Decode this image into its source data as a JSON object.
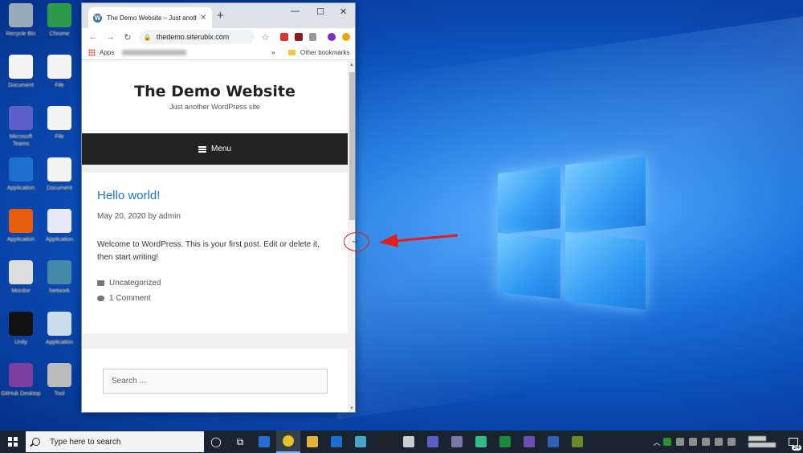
{
  "desktop": {
    "icons": [
      {
        "name": "Recycle Bin"
      },
      {
        "name": "Chrome"
      },
      {
        "name": "Document"
      },
      {
        "name": "File"
      },
      {
        "name": "Microsoft Teams"
      },
      {
        "name": "File"
      },
      {
        "name": "Application"
      },
      {
        "name": "Document"
      },
      {
        "name": "Application"
      },
      {
        "name": "Application"
      },
      {
        "name": "Monitor"
      },
      {
        "name": "Network"
      },
      {
        "name": "Unity"
      },
      {
        "name": "Application"
      },
      {
        "name": "GitHub Desktop"
      },
      {
        "name": "Tool"
      }
    ]
  },
  "browser": {
    "tab_title": "The Demo Website – Just another",
    "tab_close": "✕",
    "new_tab": "+",
    "minimize": "—",
    "maximize": "☐",
    "close": "✕",
    "back": "←",
    "forward": "→",
    "reload": "↻",
    "url": "thedemo.siterubix.com",
    "star": "☆",
    "bookmarks": {
      "apps": "Apps",
      "more": "»",
      "other": "Other bookmarks"
    }
  },
  "site": {
    "title": "The Demo Website",
    "tagline": "Just another WordPress site",
    "menu_label": "Menu",
    "post": {
      "title": "Hello world!",
      "meta": "May 20, 2020 by admin",
      "body": "Welcome to WordPress. This is your first post. Edit or delete it, then start writing!",
      "category": "Uncategorized",
      "comments": "1 Comment"
    },
    "search_placeholder": "Search ..."
  },
  "annotation": {
    "cursor": "⇔",
    "color": "#e02020"
  },
  "taskbar": {
    "search_placeholder": "Type here to search",
    "notification_count": "24",
    "colors": {
      "taskbar_bg": "#1a2430",
      "accent": "#7ab4ff"
    }
  }
}
